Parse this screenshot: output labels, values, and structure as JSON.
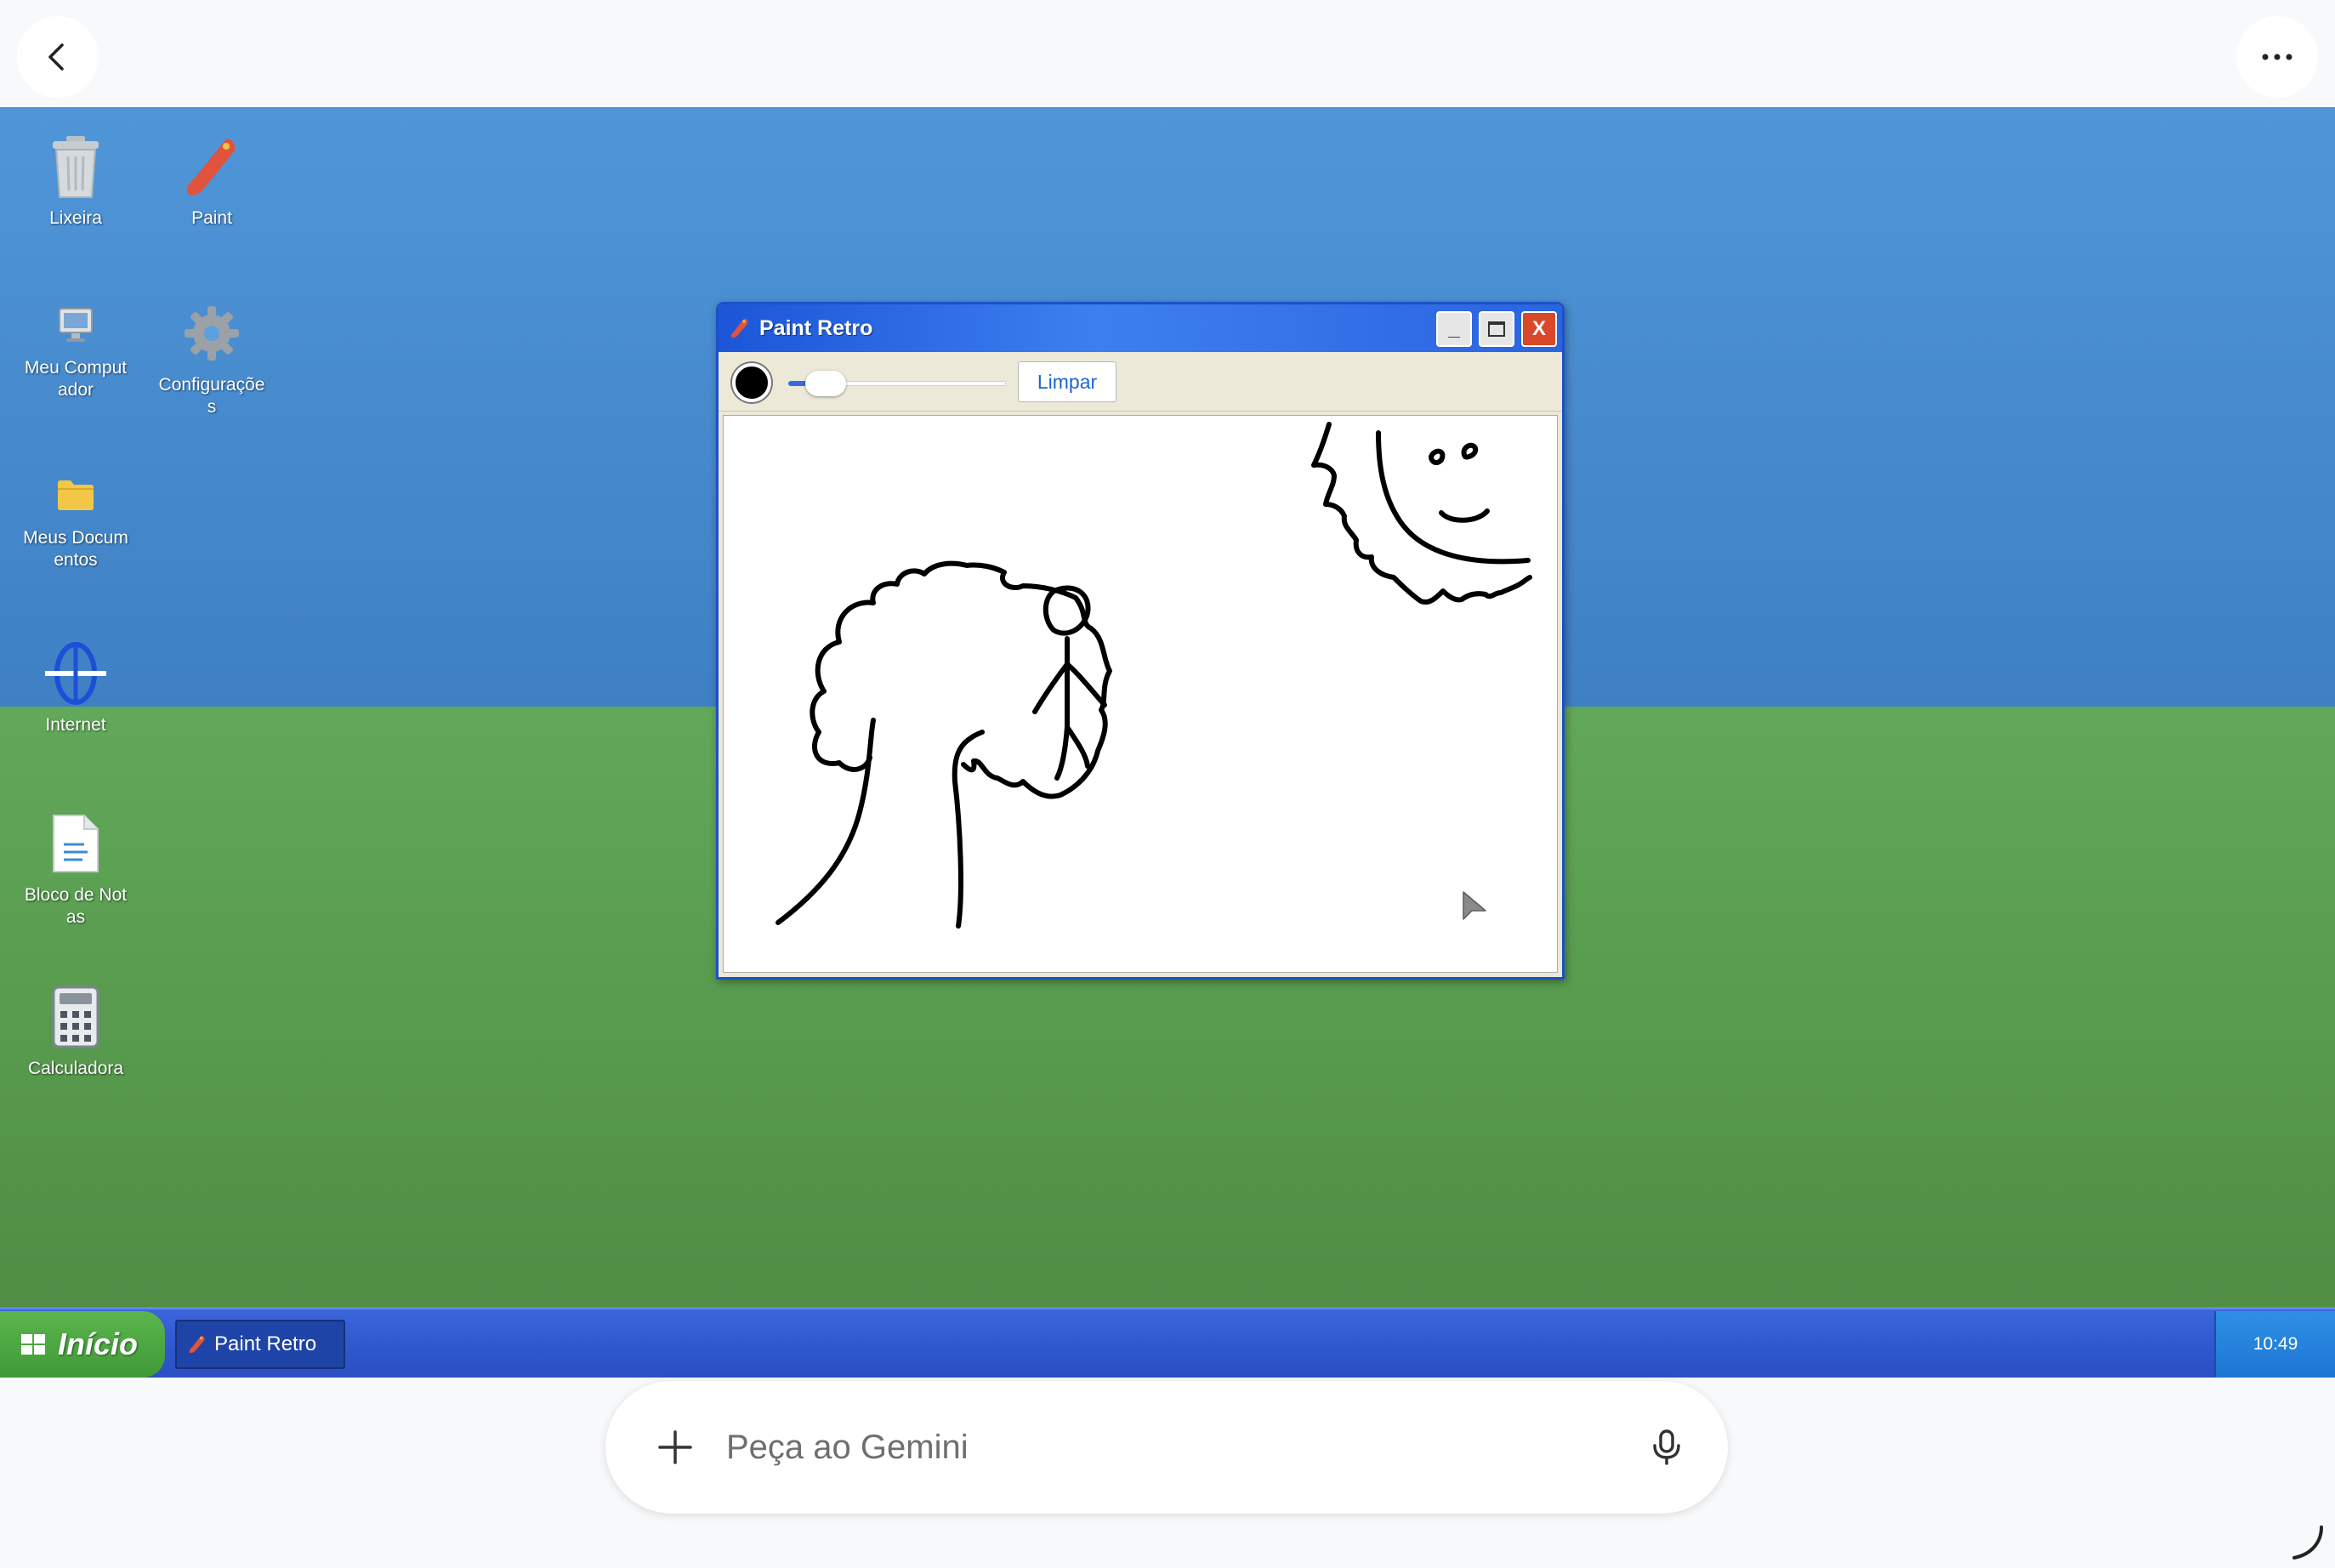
{
  "desktop": {
    "icons": [
      {
        "label": "Lixeira",
        "icon": "trash-icon"
      },
      {
        "label": "Paint",
        "icon": "paint-brush-icon"
      },
      {
        "label": "Meu Computador",
        "icon": "computer-icon"
      },
      {
        "label": "Configurações",
        "icon": "gear-icon"
      },
      {
        "label": "Meus Documentos",
        "icon": "folder-icon"
      },
      {
        "label": "Internet",
        "icon": "globe-icon"
      },
      {
        "label": "Bloco de Notas",
        "icon": "document-icon"
      },
      {
        "label": "Calculadora",
        "icon": "calculator-icon"
      }
    ]
  },
  "paint_window": {
    "title": "Paint Retro",
    "minimize": "_",
    "close": "X",
    "clear_button": "Limpar",
    "brush_color": "#000000",
    "brush_size_level": 0.1
  },
  "taskbar": {
    "start_label": "Início",
    "task_label": "Paint Retro",
    "clock": "10:49"
  },
  "gemini": {
    "placeholder": "Peça ao Gemini"
  },
  "colors": {
    "sky": "#4f96d8",
    "grass": "#5fa556",
    "taskbar": "#2f57cf",
    "start": "#4ea845",
    "title_bar": "#2a64e0"
  }
}
